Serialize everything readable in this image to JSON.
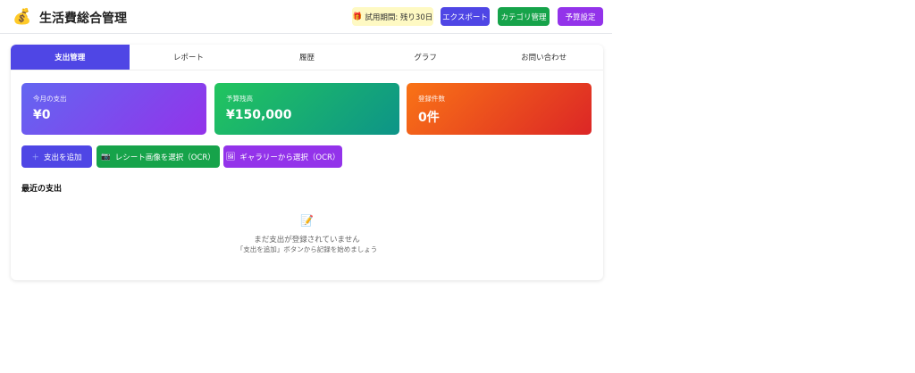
{
  "header": {
    "logo_icon": "money-bag-icon",
    "title": "生活費総合管理",
    "trial": "試用期間: 残り30日",
    "trial_icon": "gift-icon",
    "export": "エクスポート",
    "category": "カテゴリ管理",
    "budget": "予算設定"
  },
  "tabs": [
    {
      "label": "支出管理",
      "active": true
    },
    {
      "label": "レポート"
    },
    {
      "label": "履歴"
    },
    {
      "label": "グラフ"
    },
    {
      "label": "お問い合わせ"
    }
  ],
  "stats": [
    {
      "label": "今月の支出",
      "value": "¥0"
    },
    {
      "label": "予算残高",
      "value": "¥150,000"
    },
    {
      "label": "登録件数",
      "value": "0件"
    }
  ],
  "actions": {
    "add": "支出を追加",
    "receipt": "レシート画像を選択（OCR）",
    "gallery": "ギャラリーから選択（OCR）"
  },
  "recent": {
    "title": "最近の支出",
    "empty_icon": "memo-icon",
    "empty_main": "まだ支出が登録されていません",
    "empty_sub": "「支出を追加」ボタンから記録を始めましょう"
  },
  "colors": {
    "primary": "#4f46e5",
    "green": "#16a34a",
    "purple": "#9333ea",
    "trial_bg": "#fef9c3"
  }
}
